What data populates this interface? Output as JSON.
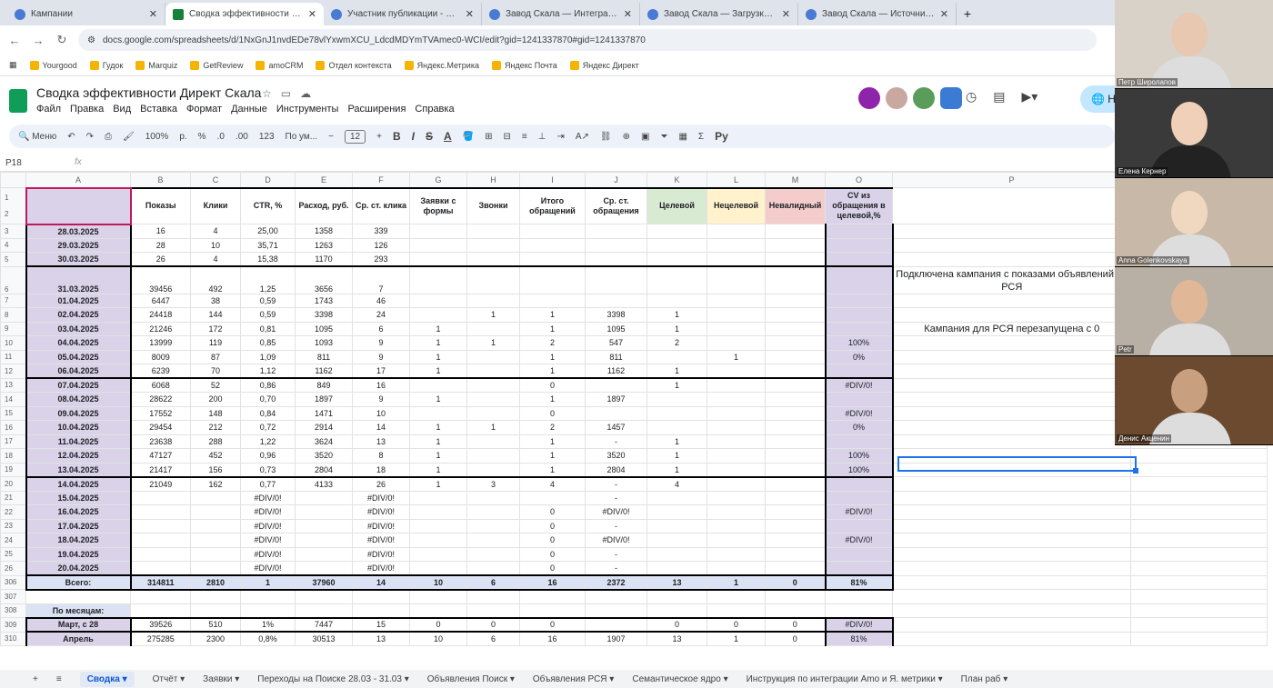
{
  "browser": {
    "tabs": [
      {
        "label": "Кампании",
        "active": false
      },
      {
        "label": "Сводка эффективности Дирек",
        "active": true
      },
      {
        "label": "Участник публикации - Zoom",
        "active": false
      },
      {
        "label": "Завод Скала — Интеграции",
        "active": false
      },
      {
        "label": "Завод Скала — Загрузка дан",
        "active": false
      },
      {
        "label": "Завод Скала — Источники, сс",
        "active": false
      }
    ],
    "url": "docs.google.com/spreadsheets/d/1NxGnJ1nvdEDe78vlYxwmXCU_LdcdMDYmTVAmec0-WCI/edit?gid=1241337870#gid=1241337870",
    "bookmarks": [
      "Yourgood",
      "Гудок",
      "Marquiz",
      "GetReview",
      "amoCRM",
      "Отдел контекста",
      "Яндекс.Метрика",
      "Яндекс Почта",
      "Яндекс Директ"
    ]
  },
  "doc": {
    "title": "Сводка эффективности Директ Скала",
    "menu": [
      "Файл",
      "Правка",
      "Вид",
      "Вставка",
      "Формат",
      "Данные",
      "Инструменты",
      "Расширения",
      "Справка"
    ],
    "share_label": "Н"
  },
  "toolbar": {
    "menu": "Меню",
    "zoom": "100%",
    "rub": "р.",
    "pct": "%",
    "dec": ".0",
    "dec2": ".00",
    "num": "123",
    "font": "По ум...",
    "size": "12",
    "b": "B",
    "i": "I",
    "s": "S",
    "a": "A",
    "sum": "Σ",
    "py": "Py"
  },
  "formula": {
    "ref": "P18",
    "fx": "fx"
  },
  "grid": {
    "cols": [
      "",
      "A",
      "B",
      "C",
      "D",
      "E",
      "F",
      "G",
      "H",
      "I",
      "J",
      "K",
      "L",
      "M",
      "O",
      "P"
    ],
    "headers": [
      "Показы",
      "Клики",
      "CTR, %",
      "Расход, руб.",
      "Ср. ст. клика",
      "Заявки с формы",
      "Звонки",
      "Итого обращений",
      "Ср. ст. обращения",
      "Целевой",
      "Нецелевой",
      "Невалидный",
      "CV из обращения в целевой,%"
    ],
    "rows": [
      {
        "n": "3",
        "a": "28.03.2025",
        "v": [
          "16",
          "4",
          "25,00",
          "1358",
          "339",
          "",
          "",
          "",
          "",
          "",
          "",
          "",
          ""
        ]
      },
      {
        "n": "4",
        "a": "29.03.2025",
        "v": [
          "28",
          "10",
          "35,71",
          "1263",
          "126",
          "",
          "",
          "",
          "",
          "",
          "",
          "",
          ""
        ]
      },
      {
        "n": "5",
        "a": "30.03.2025",
        "v": [
          "26",
          "4",
          "15,38",
          "1170",
          "293",
          "",
          "",
          "",
          "",
          "",
          "",
          "",
          ""
        ]
      },
      {
        "n": "6",
        "a": "31.03.2025",
        "v": [
          "39456",
          "492",
          "1,25",
          "3656",
          "7",
          "",
          "",
          "",
          "",
          "",
          "",
          "",
          ""
        ],
        "tall": true,
        "wk": true
      },
      {
        "n": "7",
        "a": "01.04.2025",
        "v": [
          "6447",
          "38",
          "0,59",
          "1743",
          "46",
          "",
          "",
          "",
          "",
          "",
          "",
          "",
          ""
        ]
      },
      {
        "n": "8",
        "a": "02.04.2025",
        "v": [
          "24418",
          "144",
          "0,59",
          "3398",
          "24",
          "",
          "1",
          "1",
          "3398",
          "1",
          "",
          "",
          ""
        ]
      },
      {
        "n": "9",
        "a": "03.04.2025",
        "v": [
          "21246",
          "172",
          "0,81",
          "1095",
          "6",
          "1",
          "",
          "1",
          "1095",
          "1",
          "",
          "",
          ""
        ]
      },
      {
        "n": "10",
        "a": "04.04.2025",
        "v": [
          "13999",
          "119",
          "0,85",
          "1093",
          "9",
          "1",
          "1",
          "2",
          "547",
          "2",
          "",
          "",
          "100%"
        ]
      },
      {
        "n": "11",
        "a": "05.04.2025",
        "v": [
          "8009",
          "87",
          "1,09",
          "811",
          "9",
          "1",
          "",
          "1",
          "811",
          "",
          "1",
          "",
          "0%"
        ]
      },
      {
        "n": "12",
        "a": "06.04.2025",
        "v": [
          "6239",
          "70",
          "1,12",
          "1162",
          "17",
          "1",
          "",
          "1",
          "1162",
          "1",
          "",
          "",
          ""
        ]
      },
      {
        "n": "13",
        "a": "07.04.2025",
        "v": [
          "6068",
          "52",
          "0,86",
          "849",
          "16",
          "",
          "",
          "0",
          "",
          "1",
          "",
          "",
          "#DIV/0!"
        ],
        "wk": true
      },
      {
        "n": "14",
        "a": "08.04.2025",
        "v": [
          "28622",
          "200",
          "0,70",
          "1897",
          "9",
          "1",
          "",
          "1",
          "1897",
          "",
          "",
          "",
          ""
        ]
      },
      {
        "n": "15",
        "a": "09.04.2025",
        "v": [
          "17552",
          "148",
          "0,84",
          "1471",
          "10",
          "",
          "",
          "0",
          "",
          "",
          "",
          "",
          "#DIV/0!"
        ]
      },
      {
        "n": "16",
        "a": "10.04.2025",
        "v": [
          "29454",
          "212",
          "0,72",
          "2914",
          "14",
          "1",
          "1",
          "2",
          "1457",
          "",
          "",
          "",
          "0%"
        ]
      },
      {
        "n": "17",
        "a": "11.04.2025",
        "v": [
          "23638",
          "288",
          "1,22",
          "3624",
          "13",
          "1",
          "",
          "1",
          "-",
          "1",
          "",
          "",
          ""
        ]
      },
      {
        "n": "18",
        "a": "12.04.2025",
        "v": [
          "47127",
          "452",
          "0,96",
          "3520",
          "8",
          "1",
          "",
          "1",
          "3520",
          "1",
          "",
          "",
          "100%"
        ]
      },
      {
        "n": "19",
        "a": "13.04.2025",
        "v": [
          "21417",
          "156",
          "0,73",
          "2804",
          "18",
          "1",
          "",
          "1",
          "2804",
          "1",
          "",
          "",
          "100%"
        ]
      },
      {
        "n": "20",
        "a": "14.04.2025",
        "v": [
          "21049",
          "162",
          "0,77",
          "4133",
          "26",
          "1",
          "3",
          "4",
          "-",
          "4",
          "",
          "",
          ""
        ],
        "wk": true
      },
      {
        "n": "21",
        "a": "15.04.2025",
        "v": [
          "",
          "",
          "#DIV/0!",
          "",
          "#DIV/0!",
          "",
          "",
          "",
          "-",
          "",
          "",
          "",
          ""
        ]
      },
      {
        "n": "22",
        "a": "16.04.2025",
        "v": [
          "",
          "",
          "#DIV/0!",
          "",
          "#DIV/0!",
          "",
          "",
          "0",
          "#DIV/0!",
          "",
          "",
          "",
          "#DIV/0!"
        ]
      },
      {
        "n": "23",
        "a": "17.04.2025",
        "v": [
          "",
          "",
          "#DIV/0!",
          "",
          "#DIV/0!",
          "",
          "",
          "0",
          "-",
          "",
          "",
          "",
          ""
        ]
      },
      {
        "n": "24",
        "a": "18.04.2025",
        "v": [
          "",
          "",
          "#DIV/0!",
          "",
          "#DIV/0!",
          "",
          "",
          "0",
          "#DIV/0!",
          "",
          "",
          "",
          "#DIV/0!"
        ]
      },
      {
        "n": "25",
        "a": "19.04.2025",
        "v": [
          "",
          "",
          "#DIV/0!",
          "",
          "#DIV/0!",
          "",
          "",
          "0",
          "-",
          "",
          "",
          "",
          ""
        ]
      },
      {
        "n": "26",
        "a": "20.04.2025",
        "v": [
          "",
          "",
          "#DIV/0!",
          "",
          "#DIV/0!",
          "",
          "",
          "0",
          "-",
          "",
          "",
          "",
          ""
        ]
      }
    ],
    "total": {
      "n": "306",
      "a": "Всего:",
      "v": [
        "314811",
        "2810",
        "1",
        "37960",
        "14",
        "10",
        "6",
        "16",
        "2372",
        "13",
        "1",
        "0",
        "81%"
      ]
    },
    "month_label": {
      "n": "308",
      "a": "По месяцам:"
    },
    "months": [
      {
        "n": "309",
        "a": "Март, с 28",
        "v": [
          "39526",
          "510",
          "1%",
          "7447",
          "15",
          "0",
          "0",
          "0",
          "",
          "0",
          "0",
          "0",
          "#DIV/0!"
        ]
      },
      {
        "n": "310",
        "a": "Апрель",
        "v": [
          "275285",
          "2300",
          "0,8%",
          "30513",
          "13",
          "10",
          "6",
          "16",
          "1907",
          "13",
          "1",
          "0",
          "81%"
        ]
      }
    ],
    "notes": {
      "note1": "Подключена кампания с показами объявлений на РСЯ",
      "note2": "Кампания для РСЯ перезапущена с 0"
    }
  },
  "sheet_tabs": [
    "Сводка",
    "Отчёт",
    "Заявки",
    "Переходы на Поиске 28.03 - 31.03",
    "Объявления Поиск",
    "Объявления РСЯ",
    "Семантическое ядро",
    "Инструкция по интеграции Amo и Я. метрики",
    "План раб"
  ],
  "participants": [
    "Петр Широлапов",
    "Елена Кернер",
    "Anna Golenkovskaya",
    "Petr",
    "Денис Акценин"
  ],
  "colors": {
    "purple": "#d9d2e9",
    "green": "#d9ead3",
    "yellow": "#fff2cc",
    "red": "#f4cccc",
    "total": "#dbe2f4"
  }
}
